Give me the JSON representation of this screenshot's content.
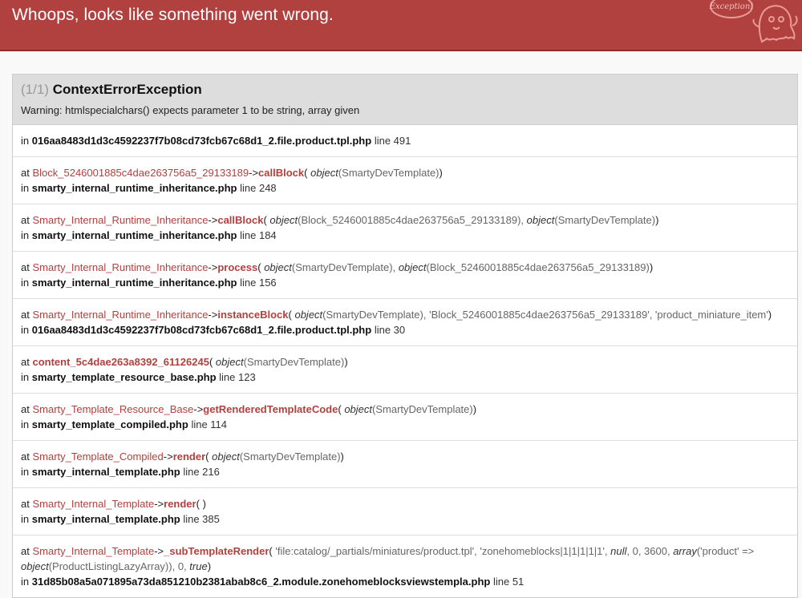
{
  "header": {
    "title": "Whoops, looks like something went wrong.",
    "logo_text": "Exception!"
  },
  "exception": {
    "count": "(1/1)",
    "name": "ContextErrorException",
    "message": "Warning: htmlspecialchars() expects parameter 1 to be string, array given"
  },
  "trace": [
    {
      "in_label": "in",
      "file": "016aa8483d1d3c4592237f7b08cd73fcb67c68d1_2.file.product.tpl.php",
      "line": "line 491"
    },
    {
      "at": "at",
      "cls": "Block_5246001885c4dae263756a5_29133189",
      "arrow": "->",
      "fn": "callBlock",
      "open": "(",
      "args": [
        {
          "t": "object",
          "v": "(SmartyDevTemplate)"
        }
      ],
      "close": ")",
      "in_label": "in",
      "file": "smarty_internal_runtime_inheritance.php",
      "line": "line 248"
    },
    {
      "at": "at",
      "cls": "Smarty_Internal_Runtime_Inheritance",
      "arrow": "->",
      "fn": "callBlock",
      "open": "(",
      "args": [
        {
          "t": "object",
          "v": "(Block_5246001885c4dae263756a5_29133189),"
        },
        {
          "t": "object",
          "v": "(SmartyDevTemplate)"
        }
      ],
      "close": ")",
      "in_label": "in",
      "file": "smarty_internal_runtime_inheritance.php",
      "line": "line 184"
    },
    {
      "at": "at",
      "cls": "Smarty_Internal_Runtime_Inheritance",
      "arrow": "->",
      "fn": "process",
      "open": "(",
      "args": [
        {
          "t": "object",
          "v": "(SmartyDevTemplate),"
        },
        {
          "t": "object",
          "v": "(Block_5246001885c4dae263756a5_29133189)"
        }
      ],
      "close": ")",
      "in_label": "in",
      "file": "smarty_internal_runtime_inheritance.php",
      "line": "line 156"
    },
    {
      "at": "at",
      "cls": "Smarty_Internal_Runtime_Inheritance",
      "arrow": "->",
      "fn": "instanceBlock",
      "open": "(",
      "args": [
        {
          "t": "object",
          "v": "(SmartyDevTemplate), 'Block_5246001885c4dae263756a5_29133189', 'product_miniature_item'"
        }
      ],
      "close": ")",
      "in_label": "in",
      "file": "016aa8483d1d3c4592237f7b08cd73fcb67c68d1_2.file.product.tpl.php",
      "line": "line 30"
    },
    {
      "at": "at",
      "cls": "",
      "arrow": "",
      "fn": "content_5c4dae263a8392_61126245",
      "open": "(",
      "args": [
        {
          "t": "object",
          "v": "(SmartyDevTemplate)"
        }
      ],
      "close": ")",
      "in_label": "in",
      "file": "smarty_template_resource_base.php",
      "line": "line 123"
    },
    {
      "at": "at",
      "cls": "Smarty_Template_Resource_Base",
      "arrow": "->",
      "fn": "getRenderedTemplateCode",
      "open": "(",
      "args": [
        {
          "t": "object",
          "v": "(SmartyDevTemplate)"
        }
      ],
      "close": ")",
      "in_label": "in",
      "file": "smarty_template_compiled.php",
      "line": "line 114"
    },
    {
      "at": "at",
      "cls": "Smarty_Template_Compiled",
      "arrow": "->",
      "fn": "render",
      "open": "(",
      "args": [
        {
          "t": "object",
          "v": "(SmartyDevTemplate)"
        }
      ],
      "close": ")",
      "in_label": "in",
      "file": "smarty_internal_template.php",
      "line": "line 216"
    },
    {
      "at": "at",
      "cls": "Smarty_Internal_Template",
      "arrow": "->",
      "fn": "render",
      "open": "(",
      "args": [],
      "close": " )",
      "in_label": "in",
      "file": "smarty_internal_template.php",
      "line": "line 385"
    },
    {
      "at": "at",
      "cls": "Smarty_Internal_Template",
      "arrow": "->",
      "fn": "_subTemplateRender",
      "open": "(",
      "args": [
        {
          "t": "",
          "v": "'file:catalog/_partials/miniatures/product.tpl', 'zonehomeblocks|1|1|1|1|1', "
        },
        {
          "t": "null",
          "v": ", 0, 3600, "
        },
        {
          "t": "array",
          "v": "('product' => "
        },
        {
          "t": "object",
          "v": "(ProductListingLazyArray)), 0, "
        },
        {
          "t": "true",
          "v": ""
        }
      ],
      "close": ")",
      "in_label": "in",
      "file": "31d85b08a5a071895a73da851210b2381abab8c6_2.module.zonehomeblocksviewstempla.php",
      "line": "line 51"
    }
  ],
  "colors": {
    "header_bg": "#b0413e",
    "accent": "#b0413e",
    "page_bg": "#f9f9f9"
  },
  "icons": {
    "logo": "ghost-exception-icon"
  }
}
